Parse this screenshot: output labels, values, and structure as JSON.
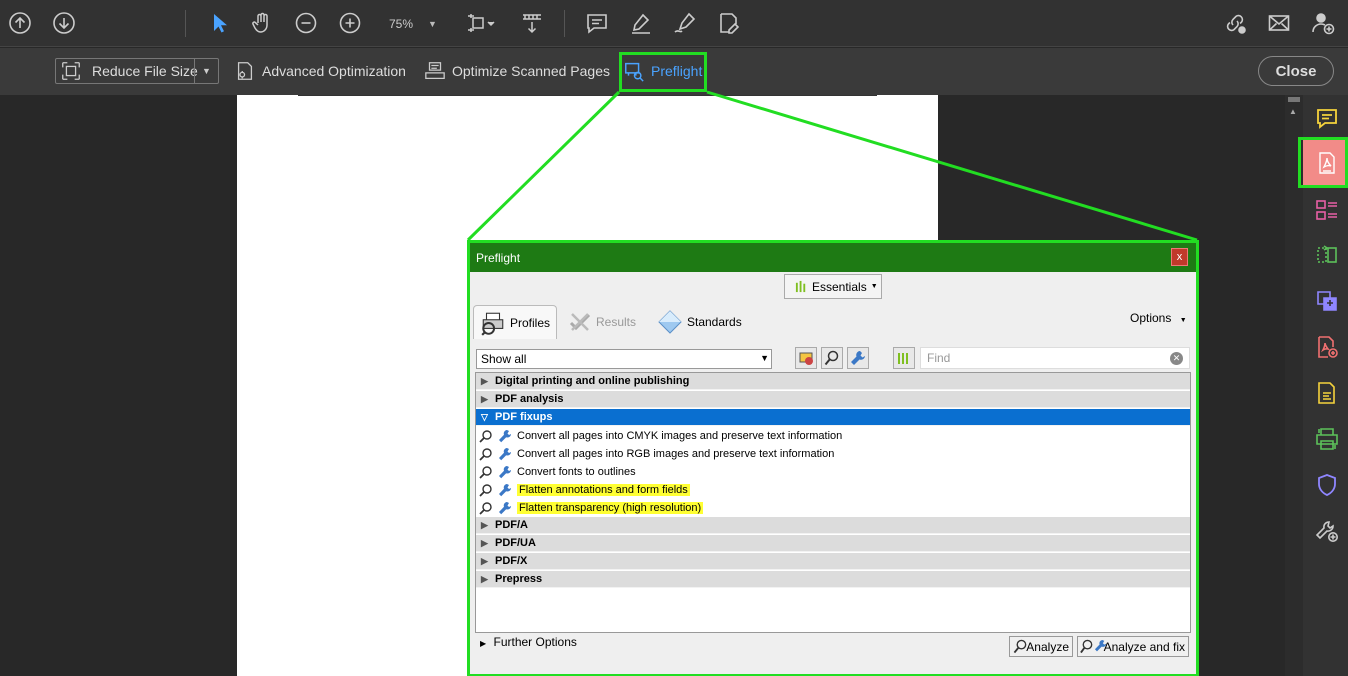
{
  "toolbar": {
    "zoom": "75%",
    "icons": [
      "page-up-icon",
      "page-down-icon",
      "select-cursor-icon",
      "hand-tool-icon",
      "zoom-out-icon",
      "zoom-in-icon",
      "fit-page-icon",
      "scroll-mode-icon",
      "comment-icon",
      "highlight-pen-icon",
      "sign-icon",
      "fill-sign-icon",
      "link-share-icon",
      "email-icon",
      "add-user-icon"
    ]
  },
  "optimize_bar": {
    "reduce_label": "Reduce File Size",
    "advanced_label": "Advanced Optimization",
    "scanned_label": "Optimize Scanned Pages",
    "preflight_label": "Preflight",
    "close_label": "Close",
    "accent_color": "#4aa3ff"
  },
  "right_rail": {
    "icons": [
      "comment-tool-icon",
      "optimize-pdf-icon",
      "organize-pages-icon",
      "compare-icon",
      "export-pdf-icon",
      "create-pdf-icon",
      "fill-sign-tool-icon",
      "print-production-icon",
      "protect-icon",
      "more-tools-icon"
    ],
    "active": "optimize-pdf-icon"
  },
  "dialog": {
    "title": "Preflight",
    "close_glyph": "x",
    "essentials_label": "Essentials",
    "tabs": [
      {
        "label": "Profiles",
        "active": true
      },
      {
        "label": "Results",
        "active": false
      },
      {
        "label": "Standards",
        "active": false
      }
    ],
    "options_label": "Options",
    "filter_value": "Show all",
    "find_placeholder": "Find",
    "tree": {
      "groups_before": [
        {
          "label": "Digital printing and online publishing"
        },
        {
          "label": "PDF analysis"
        }
      ],
      "open_group": {
        "label": "PDF fixups"
      },
      "items": [
        {
          "label": "Convert all pages into CMYK images and preserve text information",
          "highlighted": false
        },
        {
          "label": "Convert all pages into RGB images and preserve text information",
          "highlighted": false
        },
        {
          "label": "Convert fonts to outlines",
          "highlighted": false
        },
        {
          "label": "Flatten annotations and form fields",
          "highlighted": true
        },
        {
          "label": "Flatten transparency (high resolution)",
          "highlighted": true
        }
      ],
      "groups_after": [
        {
          "label": "PDF/A"
        },
        {
          "label": "PDF/UA"
        },
        {
          "label": "PDF/X"
        },
        {
          "label": "Prepress"
        }
      ]
    },
    "further_options": "Further Options",
    "analyze_label": "Analyze",
    "analyze_fix_label": "Analyze and fix",
    "title_color": "#1e7a14",
    "selection_color": "#0a6fd0",
    "highlight_color": "#ffff33"
  },
  "callout_color": "#22dd22"
}
